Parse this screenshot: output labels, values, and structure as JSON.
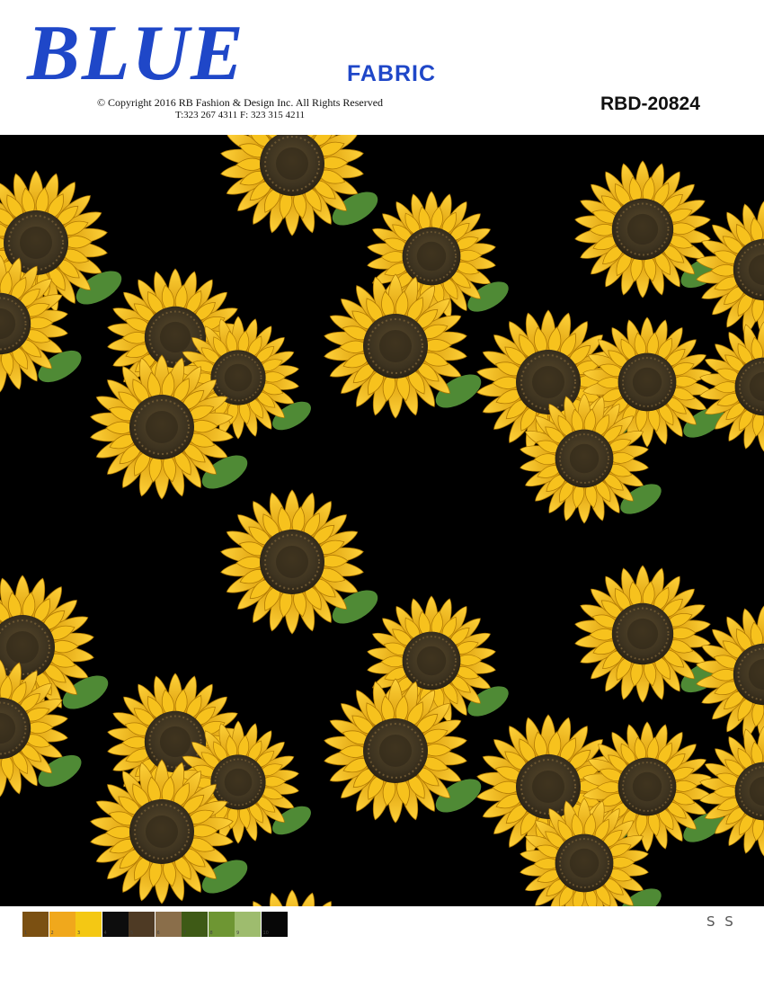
{
  "header": {
    "brand": "BLUE",
    "brand_sub": "FABRIC",
    "copyright_line1": "© Copyright  2016 RB Fashion & Design Inc. All Rights Reserved",
    "copyright_line2": "T:323 267 4311   F: 323 315 4211",
    "design_code": "RBD-20824"
  },
  "colors": {
    "brand_blue": "#1f47c8",
    "background": "#000000",
    "petal": "#f2b90e",
    "center": "#3d3320",
    "leaf": "#4f8a35"
  },
  "pattern": {
    "motif": "sunflower",
    "icon": "sunflower-icon"
  },
  "palette": {
    "swatches": [
      {
        "label": "1",
        "color": "#7b5012"
      },
      {
        "label": "2",
        "color": "#f0a81c"
      },
      {
        "label": "3",
        "color": "#f4c814"
      },
      {
        "label": "4",
        "color": "#0d0d0d"
      },
      {
        "label": "5",
        "color": "#4e3a24"
      },
      {
        "label": "6",
        "color": "#8a6e4a"
      },
      {
        "label": "7",
        "color": "#3e5a16"
      },
      {
        "label": "8",
        "color": "#6e9633"
      },
      {
        "label": "9",
        "color": "#9ebc6e"
      },
      {
        "label": "10",
        "color": "#070707"
      }
    ]
  },
  "size_label": "S S"
}
